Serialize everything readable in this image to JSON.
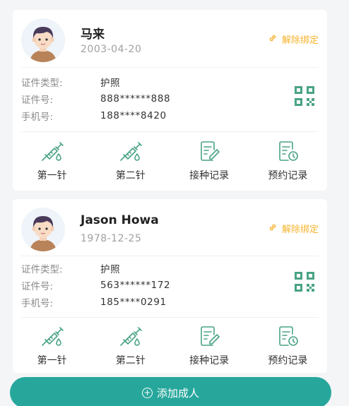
{
  "colors": {
    "accent": "#27a79c",
    "unbind": "#f5b32b",
    "icon": "#4aa386"
  },
  "icons": {
    "unbind": "link-icon",
    "qr": "qr-code-icon",
    "add": "plus-circle-icon",
    "actions": [
      "syringe-icon",
      "syringe-icon",
      "document-edit-icon",
      "calendar-clock-icon"
    ]
  },
  "people": [
    {
      "name": "马来",
      "dob": "2003-04-20",
      "unbind_label": "解除绑定",
      "fields": [
        {
          "key": "证件类型:",
          "value": "护照"
        },
        {
          "key": "证件号:",
          "value": "888******888"
        },
        {
          "key": "手机号:",
          "value": "188****8420"
        }
      ],
      "actions": [
        "第一针",
        "第二针",
        "接种记录",
        "预约记录"
      ]
    },
    {
      "name": "Jason Howa",
      "dob": "1978-12-25",
      "unbind_label": "解除绑定",
      "fields": [
        {
          "key": "证件类型:",
          "value": "护照"
        },
        {
          "key": "证件号:",
          "value": "563******172"
        },
        {
          "key": "手机号:",
          "value": "185****0291"
        }
      ],
      "actions": [
        "第一针",
        "第二针",
        "接种记录",
        "预约记录"
      ]
    }
  ],
  "add_button": {
    "label": "添加成人"
  }
}
